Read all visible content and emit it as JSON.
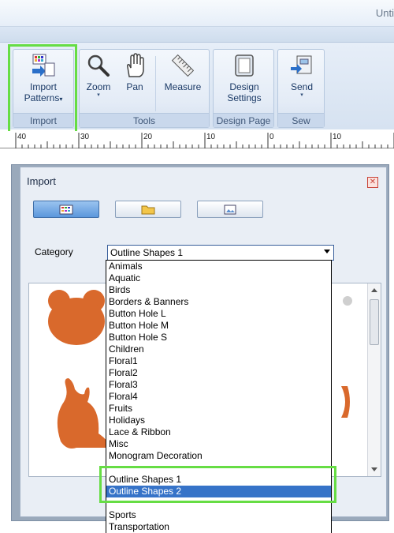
{
  "window": {
    "title_fragment": "Unti"
  },
  "ribbon": {
    "groups": [
      {
        "label": "Import"
      },
      {
        "label": "Tools"
      },
      {
        "label": "Design Page"
      },
      {
        "label": "Sew"
      }
    ],
    "buttons": {
      "import_patterns": {
        "line1": "Import",
        "line2": "Patterns"
      },
      "zoom": "Zoom",
      "pan": "Pan",
      "measure": "Measure",
      "design_settings": {
        "line1": "Design",
        "line2": "Settings"
      },
      "send": "Send"
    },
    "dropdown_marker": "▾"
  },
  "ruler": {
    "labels": [
      "40",
      "30",
      "20",
      "10",
      "0",
      "10"
    ]
  },
  "import_panel": {
    "title": "Import",
    "close_glyph": "✕",
    "category_label": "Category",
    "category_value": "Outline Shapes 1",
    "preview_color": "#d9692c",
    "dropdown_items": [
      {
        "label": "Animals",
        "selected": false
      },
      {
        "label": "Aquatic",
        "selected": false
      },
      {
        "label": "Birds",
        "selected": false
      },
      {
        "label": "Borders & Banners",
        "selected": false
      },
      {
        "label": "Button Hole L",
        "selected": false
      },
      {
        "label": "Button Hole M",
        "selected": false
      },
      {
        "label": "Button Hole S",
        "selected": false
      },
      {
        "label": "Children",
        "selected": false
      },
      {
        "label": "Floral1",
        "selected": false
      },
      {
        "label": "Floral2",
        "selected": false
      },
      {
        "label": "Floral3",
        "selected": false
      },
      {
        "label": "Floral4",
        "selected": false
      },
      {
        "label": "Fruits",
        "selected": false
      },
      {
        "label": "Holidays",
        "selected": false
      },
      {
        "label": "Lace & Ribbon",
        "selected": false
      },
      {
        "label": "Misc",
        "selected": false
      },
      {
        "label": "Monogram Decoration",
        "selected": false
      },
      {
        "label": "Outline Shapes 1",
        "selected": false
      },
      {
        "label": "Outline Shapes 2",
        "selected": true
      },
      {
        "label": "Sports",
        "selected": false
      },
      {
        "label": "Transportation",
        "selected": false
      }
    ]
  },
  "colors": {
    "highlight": "#66dd44",
    "selection": "#3673c8",
    "ribbon_text": "#1b3a66"
  }
}
